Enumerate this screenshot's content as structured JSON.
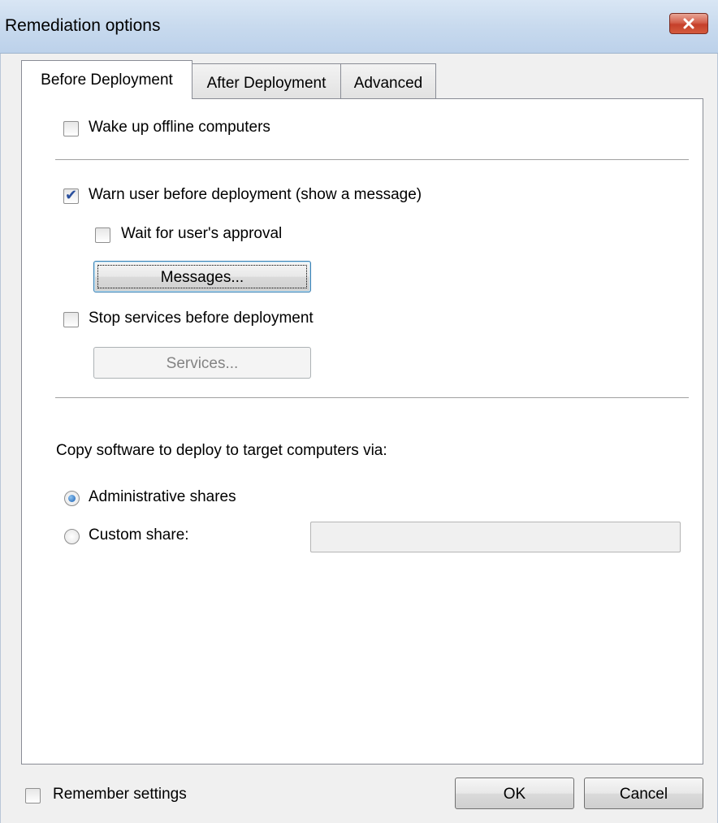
{
  "window": {
    "title": "Remediation options"
  },
  "tabs": [
    {
      "label": "Before Deployment",
      "active": true
    },
    {
      "label": "After Deployment",
      "active": false
    },
    {
      "label": "Advanced",
      "active": false
    }
  ],
  "options": {
    "wake_up": {
      "label": "Wake up offline computers",
      "checked": false
    },
    "warn_user": {
      "label": "Warn user before deployment (show a message)",
      "checked": true
    },
    "wait_approval": {
      "label": "Wait for user's approval",
      "checked": false
    },
    "messages_button": "Messages...",
    "stop_services": {
      "label": "Stop services before deployment",
      "checked": false
    },
    "services_button": "Services..."
  },
  "copy": {
    "heading": "Copy software to deploy to target computers via:",
    "admin_shares": {
      "label": "Administrative shares",
      "selected": true
    },
    "custom_share": {
      "label": "Custom share:",
      "selected": false,
      "value": ""
    }
  },
  "footer": {
    "remember": {
      "label": "Remember settings",
      "checked": false
    },
    "ok": "OK",
    "cancel": "Cancel"
  }
}
